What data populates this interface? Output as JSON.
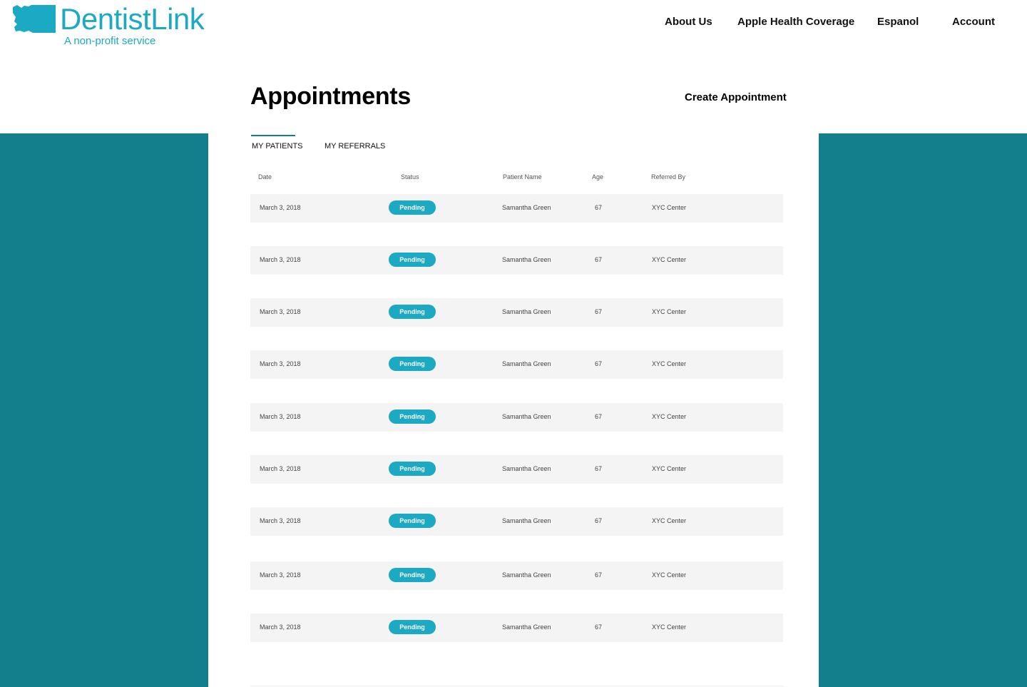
{
  "brand": {
    "name": "DentistLink",
    "tagline": "A non-profit service",
    "color": "#1ba9c3",
    "logo_icon": "washington-state-icon"
  },
  "nav": {
    "items": [
      "About Us",
      "Apple Health Coverage",
      "Espanol",
      "Account"
    ]
  },
  "page": {
    "title": "Appointments",
    "create_label": "Create Appointment"
  },
  "tabs": [
    {
      "label": "MY PATIENTS",
      "active": true
    },
    {
      "label": "MY REFERRALS",
      "active": false
    }
  ],
  "table": {
    "columns": [
      "Date",
      "Status",
      "Patient Name",
      "Age",
      "Referred By"
    ],
    "rows": [
      {
        "date": "March 3, 2018",
        "status": "Pending",
        "patient": "Samantha Green",
        "age": "67",
        "referred_by": "XYC Center"
      },
      {
        "date": "March 3, 2018",
        "status": "Pending",
        "patient": "Samantha Green",
        "age": "67",
        "referred_by": "XYC Center"
      },
      {
        "date": "March 3, 2018",
        "status": "Pending",
        "patient": "Samantha Green",
        "age": "67",
        "referred_by": "XYC Center"
      },
      {
        "date": "March 3, 2018",
        "status": "Pending",
        "patient": "Samantha Green",
        "age": "67",
        "referred_by": "XYC Center"
      },
      {
        "date": "March 3, 2018",
        "status": "Pending",
        "patient": "Samantha Green",
        "age": "67",
        "referred_by": "XYC Center"
      },
      {
        "date": "March 3, 2018",
        "status": "Pending",
        "patient": "Samantha Green",
        "age": "67",
        "referred_by": "XYC Center"
      },
      {
        "date": "March 3, 2018",
        "status": "Pending",
        "patient": "Samantha Green",
        "age": "67",
        "referred_by": "XYC Center"
      },
      {
        "date": "March 3, 2018",
        "status": "Pending",
        "patient": "Samantha Green",
        "age": "67",
        "referred_by": "XYC Center"
      },
      {
        "date": "March 3, 2018",
        "status": "Pending",
        "patient": "Samantha Green",
        "age": "67",
        "referred_by": "XYC Center"
      }
    ]
  },
  "colors": {
    "accent": "#1ba9c3",
    "background_band": "#147f8c",
    "row_background": "#f4f4f4"
  }
}
